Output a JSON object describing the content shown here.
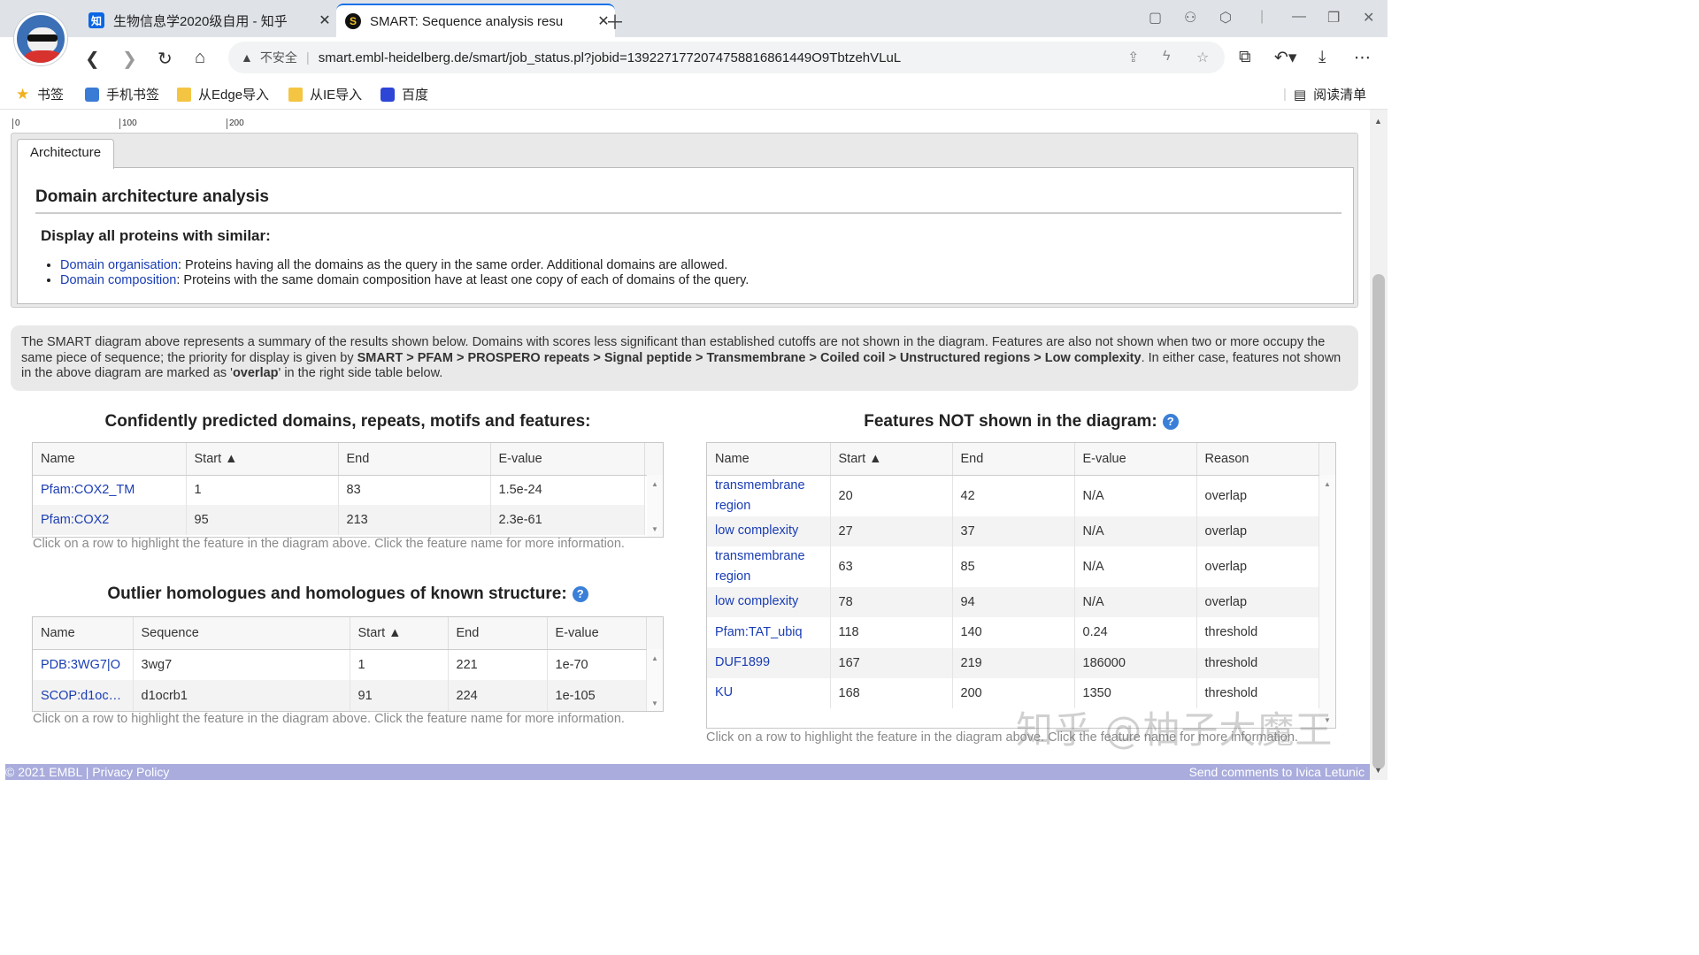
{
  "browser": {
    "tabs": [
      {
        "favicon": "知",
        "title": "生物信息学2020级自用 - 知乎"
      },
      {
        "favicon": "S",
        "title": "SMART: Sequence analysis resu"
      }
    ],
    "security_label": "不安全",
    "url": "smart.embl-heidelberg.de/smart/job_status.pl?jobid=1392271772074758816861449O9TbtzehVLuL",
    "bookmarks": [
      "书签",
      "手机书签",
      "从Edge导入",
      "从IE导入",
      "百度"
    ],
    "reading_list": "阅读清单"
  },
  "ruler": {
    "ticks": [
      "0",
      "100",
      "200"
    ]
  },
  "architecture": {
    "tab_label": "Architecture",
    "title": "Domain architecture analysis",
    "subtitle": "Display all proteins with similar:",
    "items": [
      {
        "link": "Domain organisation",
        "text": ": Proteins having all the domains as the query in the same order. Additional domains are allowed."
      },
      {
        "link": "Domain composition",
        "text": ": Proteins with the same domain composition have at least one copy of each of domains of the query."
      }
    ]
  },
  "note": {
    "part1": "The SMART diagram above represents a summary of the results shown below. Domains with scores less significant than established cutoffs are not shown in the diagram. Features are also not shown when two or more occupy the same piece of sequence; the priority for display is given by ",
    "priority": "SMART > PFAM > PROSPERO repeats > Signal peptide > Transmembrane > Coiled coil > Unstructured regions > Low complexity",
    "part2": ". In either case, features not shown in the above diagram are marked as '",
    "overlap": "overlap",
    "part3": "' in the right side table below."
  },
  "confident": {
    "title": "Confidently predicted domains, repeats, motifs and features:",
    "columns": [
      "Name",
      "Start ▲",
      "End",
      "E-value"
    ],
    "rows": [
      {
        "name": "Pfam:COX2_TM",
        "start": "1",
        "end": "83",
        "evalue": "1.5e-24"
      },
      {
        "name": "Pfam:COX2",
        "start": "95",
        "end": "213",
        "evalue": "2.3e-61"
      }
    ],
    "hint": "Click on a row to highlight the feature in the diagram above. Click the feature name for more information."
  },
  "outlier": {
    "title": "Outlier homologues and homologues of known structure:",
    "columns": [
      "Name",
      "Sequence",
      "Start ▲",
      "End",
      "E-value"
    ],
    "rows": [
      {
        "name": "PDB:3WG7|O",
        "sequence": "3wg7",
        "start": "1",
        "end": "221",
        "evalue": "1e-70"
      },
      {
        "name": "SCOP:d1oc…",
        "sequence": "d1ocrb1",
        "start": "91",
        "end": "224",
        "evalue": "1e-105"
      }
    ],
    "hint": "Click on a row to highlight the feature in the diagram above. Click the feature name for more information."
  },
  "notshown": {
    "title": "Features NOT shown in the diagram:",
    "columns": [
      "Name",
      "Start ▲",
      "End",
      "E-value",
      "Reason"
    ],
    "rows": [
      {
        "name": "transmembrane region",
        "start": "20",
        "end": "42",
        "evalue": "N/A",
        "reason": "overlap"
      },
      {
        "name": "low complexity",
        "start": "27",
        "end": "37",
        "evalue": "N/A",
        "reason": "overlap"
      },
      {
        "name": "transmembrane region",
        "start": "63",
        "end": "85",
        "evalue": "N/A",
        "reason": "overlap"
      },
      {
        "name": "low complexity",
        "start": "78",
        "end": "94",
        "evalue": "N/A",
        "reason": "overlap"
      },
      {
        "name": "Pfam:TAT_ubiq",
        "start": "118",
        "end": "140",
        "evalue": "0.24",
        "reason": "threshold"
      },
      {
        "name": "DUF1899",
        "start": "167",
        "end": "219",
        "evalue": "186000",
        "reason": "threshold"
      },
      {
        "name": "KU",
        "start": "168",
        "end": "200",
        "evalue": "1350",
        "reason": "threshold"
      }
    ],
    "hint": "Click on a row to highlight the feature in the diagram above. Click the feature name for more information."
  },
  "footer": {
    "copyright": "© 2021 EMBL | ",
    "privacy": "Privacy Policy",
    "comments": "Send comments to Ivica Letunic"
  },
  "watermark": "知乎 @柚子大魔王",
  "colors": {
    "link": "#1a3db4",
    "footer": "#a9acdc",
    "panel": "#e9e9e9"
  }
}
